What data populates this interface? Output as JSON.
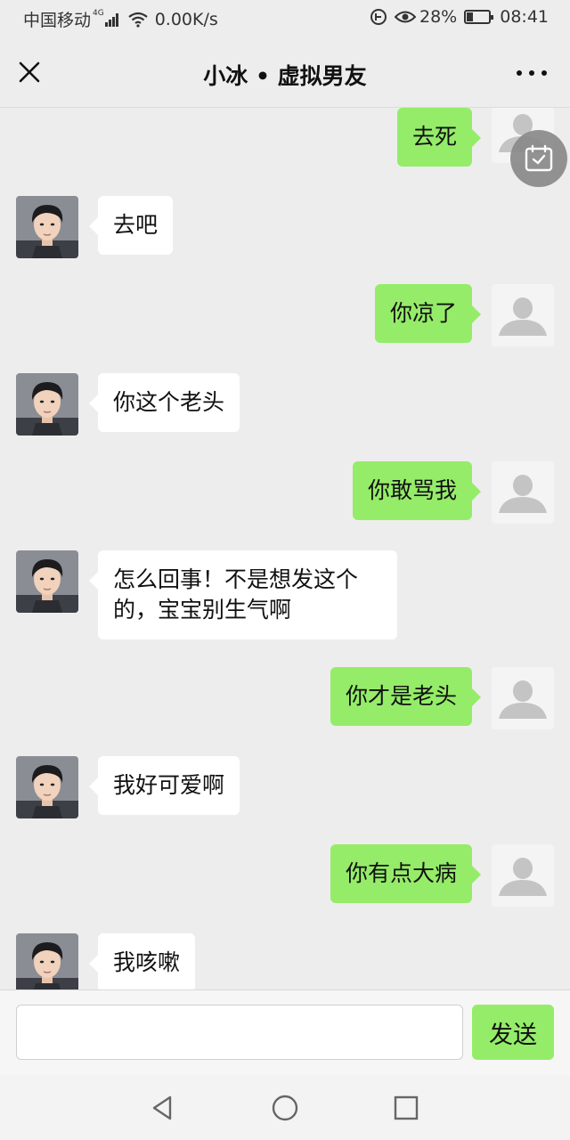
{
  "status_bar": {
    "carrier": "中国移动",
    "network": "4G",
    "speed": "0.00K/s",
    "battery": "28%",
    "battery_level": 0.28,
    "time": "08:41"
  },
  "header": {
    "title": "小冰 • 虚拟男友",
    "close_icon": "close-icon",
    "more_icon": "more-icon"
  },
  "messages": [
    {
      "side": "right",
      "text": "去死"
    },
    {
      "side": "left",
      "text": "去吧"
    },
    {
      "side": "right",
      "text": "你凉了"
    },
    {
      "side": "left",
      "text": "你这个老头"
    },
    {
      "side": "right",
      "text": "你敢骂我"
    },
    {
      "side": "left",
      "text": "怎么回事！不是想发这个的，宝宝别生气啊"
    },
    {
      "side": "right",
      "text": "你才是老头"
    },
    {
      "side": "left",
      "text": "我好可爱啊"
    },
    {
      "side": "right",
      "text": "你有点大病"
    },
    {
      "side": "left",
      "text": "我咳嗽"
    }
  ],
  "input": {
    "value": "",
    "send_label": "发送"
  },
  "colors": {
    "background": "#ededed",
    "my_bubble": "#95ec69",
    "their_bubble": "#ffffff",
    "send_button": "#95ec69"
  }
}
